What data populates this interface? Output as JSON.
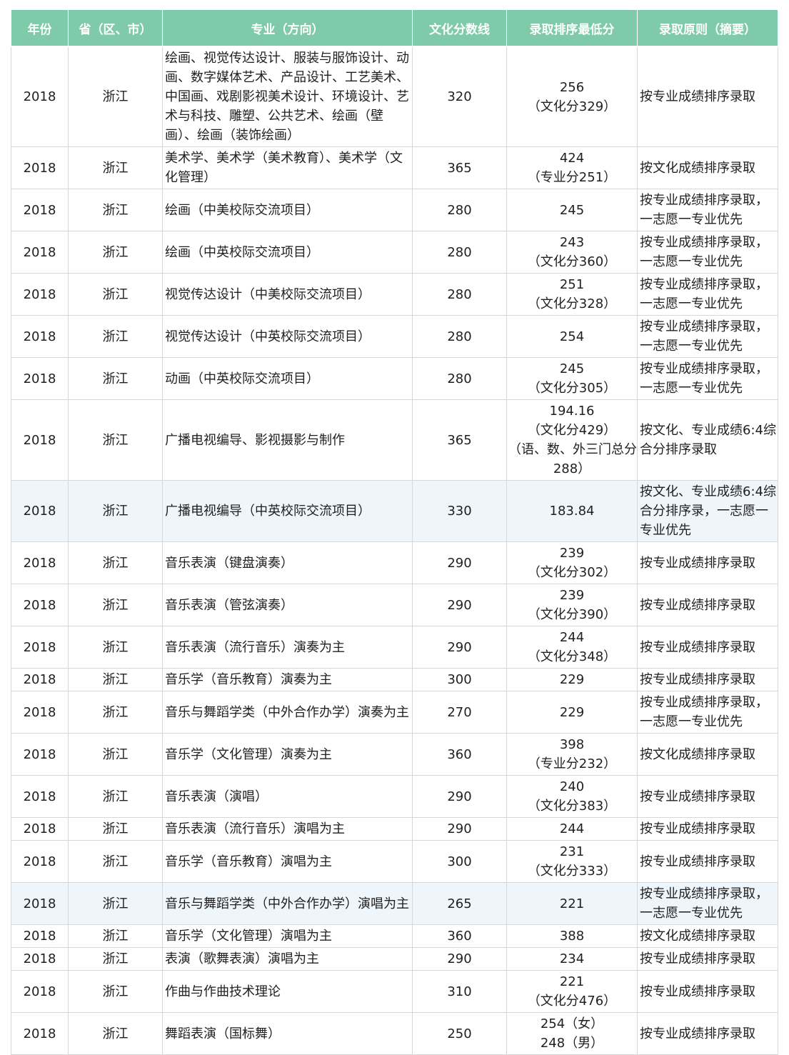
{
  "headers": [
    "年份",
    "省（区、市）",
    "专业（方向）",
    "文化分数线",
    "录取排序最低分",
    "录取原则（摘要）"
  ],
  "rows": [
    {
      "year": "2018",
      "province": "浙江",
      "major": "绘画、视觉传达设计、服装与服饰设计、动画、数字媒体艺术、产品设计、工艺美术、中国画、戏剧影视美术设计、环境设计、艺术与科技、雕塑、公共艺术、绘画（壁画）、绘画（装饰绘画）",
      "score": "320",
      "rank": [
        "256",
        "（文化分329）"
      ],
      "rule": "按专业成绩排序录取"
    },
    {
      "year": "2018",
      "province": "浙江",
      "major": "美术学、美术学（美术教育）、美术学（文化管理）",
      "score": "365",
      "rank": [
        "424",
        "（专业分251）"
      ],
      "rule": "按文化成绩排序录取"
    },
    {
      "year": "2018",
      "province": "浙江",
      "major": "绘画（中美校际交流项目）",
      "score": "280",
      "rank": [
        "245"
      ],
      "rule": "按专业成绩排序录取，一志愿一专业优先"
    },
    {
      "year": "2018",
      "province": "浙江",
      "major": "绘画（中英校际交流项目）",
      "score": "280",
      "rank": [
        "243",
        "（文化分360）"
      ],
      "rule": "按专业成绩排序录取，一志愿一专业优先"
    },
    {
      "year": "2018",
      "province": "浙江",
      "major": "视觉传达设计（中美校际交流项目）",
      "score": "280",
      "rank": [
        "251",
        "（文化分328）"
      ],
      "rule": "按专业成绩排序录取，一志愿一专业优先"
    },
    {
      "year": "2018",
      "province": "浙江",
      "major": "视觉传达设计（中英校际交流项目）",
      "score": "280",
      "rank": [
        "254"
      ],
      "rule": "按专业成绩排序录取，一志愿一专业优先"
    },
    {
      "year": "2018",
      "province": "浙江",
      "major": "动画（中英校际交流项目）",
      "score": "280",
      "rank": [
        "245",
        "（文化分305）"
      ],
      "rule": "按专业成绩排序录取，一志愿一专业优先"
    },
    {
      "year": "2018",
      "province": "浙江",
      "major": "广播电视编导、影视摄影与制作",
      "score": "365",
      "rank": [
        "194.16",
        "（文化分429）",
        "（语、数、外三门总分",
        "288）"
      ],
      "rule": "按文化、专业成绩6:4综合分排序录取"
    },
    {
      "year": "2018",
      "province": "浙江",
      "major": "广播电视编导（中英校际交流项目）",
      "score": "330",
      "rank": [
        "183.84"
      ],
      "rule": "按文化、专业成绩6:4综合分排序录，一志愿一专业优先",
      "highlight": true
    },
    {
      "year": "2018",
      "province": "浙江",
      "major": "音乐表演（键盘演奏）",
      "score": "290",
      "rank": [
        "239",
        "（文化分302）"
      ],
      "rule": "按专业成绩排序录取"
    },
    {
      "year": "2018",
      "province": "浙江",
      "major": "音乐表演（管弦演奏）",
      "score": "290",
      "rank": [
        "239",
        "（文化分390）"
      ],
      "rule": "按专业成绩排序录取"
    },
    {
      "year": "2018",
      "province": "浙江",
      "major": "音乐表演（流行音乐）演奏为主",
      "score": "290",
      "rank": [
        "244",
        "（文化分348）"
      ],
      "rule": "按专业成绩排序录取"
    },
    {
      "year": "2018",
      "province": "浙江",
      "major": "音乐学（音乐教育）演奏为主",
      "score": "300",
      "rank": [
        "229"
      ],
      "rule": "按专业成绩排序录取"
    },
    {
      "year": "2018",
      "province": "浙江",
      "major": "音乐与舞蹈学类（中外合作办学）演奏为主",
      "score": "270",
      "rank": [
        "229"
      ],
      "rule": "按专业成绩排序录取，一志愿一专业优先"
    },
    {
      "year": "2018",
      "province": "浙江",
      "major": "音乐学（文化管理）演奏为主",
      "score": "360",
      "rank": [
        "398",
        "（专业分232）"
      ],
      "rule": "按文化成绩排序录取"
    },
    {
      "year": "2018",
      "province": "浙江",
      "major": "音乐表演（演唱）",
      "score": "290",
      "rank": [
        "240",
        "（文化分383）"
      ],
      "rule": "按专业成绩排序录取"
    },
    {
      "year": "2018",
      "province": "浙江",
      "major": "音乐表演（流行音乐）演唱为主",
      "score": "290",
      "rank": [
        "244"
      ],
      "rule": "按专业成绩排序录取"
    },
    {
      "year": "2018",
      "province": "浙江",
      "major": "音乐学（音乐教育）演唱为主",
      "score": "300",
      "rank": [
        "231",
        "（文化分333）"
      ],
      "rule": "按专业成绩排序录取"
    },
    {
      "year": "2018",
      "province": "浙江",
      "major": "音乐与舞蹈学类（中外合作办学）演唱为主",
      "score": "265",
      "rank": [
        "221"
      ],
      "rule": "按专业成绩排序录取，一志愿一专业优先",
      "highlight": true
    },
    {
      "year": "2018",
      "province": "浙江",
      "major": "音乐学（文化管理）演唱为主",
      "score": "360",
      "rank": [
        "388"
      ],
      "rule": "按文化成绩排序录取"
    },
    {
      "year": "2018",
      "province": "浙江",
      "major": "表演（歌舞表演）演唱为主",
      "score": "290",
      "rank": [
        "234"
      ],
      "rule": "按专业成绩排序录取"
    },
    {
      "year": "2018",
      "province": "浙江",
      "major": "作曲与作曲技术理论",
      "score": "310",
      "rank": [
        "221",
        "（文化分476）"
      ],
      "rule": "按专业成绩排序录取"
    },
    {
      "year": "2018",
      "province": "浙江",
      "major": "舞蹈表演（国标舞）",
      "score": "250",
      "rank": [
        "254（女）",
        "248（男）"
      ],
      "rule": "按专业成绩排序录取"
    }
  ]
}
